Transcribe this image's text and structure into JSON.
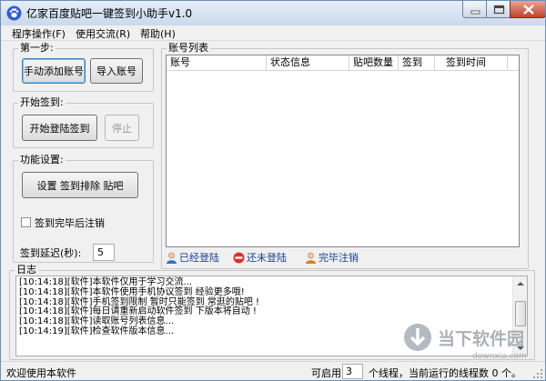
{
  "window": {
    "title": "亿家百度贴吧一键签到小助手v1.0"
  },
  "menu": [
    "程序操作(F)",
    "使用交流(R)",
    "帮助(H)"
  ],
  "step1": {
    "title": "第一步:",
    "add_manual": "手动添加账号",
    "import": "导入账号"
  },
  "start": {
    "title": "开始签到:",
    "login_sign": "开始登陆签到",
    "stop": "停止"
  },
  "features": {
    "title": "功能设置:",
    "settings_button": "设置 签到排除 贴吧",
    "logout_checkbox": "签到完毕后注销",
    "logout_checked": false,
    "delay_label": "签到延迟(秒):",
    "delay_value": "5"
  },
  "accounts": {
    "title": "账号列表",
    "columns": [
      "账号",
      "状态信息",
      "贴吧数量",
      "签到",
      "签到时间"
    ],
    "rows": []
  },
  "legend": [
    {
      "label": "已经登陆",
      "icon": "user-blue-icon",
      "color": "#3a6fc4"
    },
    {
      "label": "还未登陆",
      "icon": "no-entry-red-icon",
      "color": "#d9342b"
    },
    {
      "label": "完毕注销",
      "icon": "user-orange-icon",
      "color": "#e07a1f"
    }
  ],
  "log": {
    "title": "日志",
    "lines": [
      "[10:14:18][软件]本软件仅用于学习交流...",
      "[10:14:18][软件]本软件使用手机协议签到 经验更多哦!",
      "[10:14:18][软件]手机签到限制 暂时只能签到 常逛的贴吧 !",
      "[10:14:18][软件]每日请重新启动软件签到 下版本将自动 !",
      "[10:14:18][软件]读取账号列表信息...",
      "[10:14:19][软件]检查软件版本信息..."
    ]
  },
  "status": {
    "welcome": "欢迎使用本软件",
    "threads_prefix": "可启用",
    "threads_value": "3",
    "threads_suffix": "个线程，当前运行的线程数 0 个。"
  },
  "watermark": {
    "text": "当下软件园",
    "url_text": "downxia.com"
  }
}
